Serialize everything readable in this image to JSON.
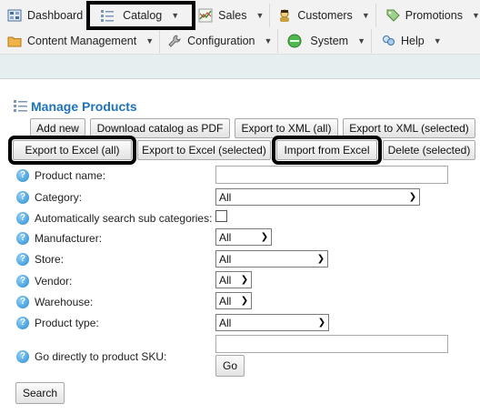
{
  "menu": {
    "row1": [
      {
        "label": "Dashboard",
        "icon": "dashboard-icon"
      },
      {
        "label": "Catalog",
        "icon": "catalog-icon",
        "highlighted": true
      },
      {
        "label": "Sales",
        "icon": "sales-chart-icon"
      },
      {
        "label": "Customers",
        "icon": "customers-icon"
      },
      {
        "label": "Promotions",
        "icon": "promotions-tag-icon"
      }
    ],
    "row2": [
      {
        "label": "Content Management",
        "icon": "folder-icon"
      },
      {
        "label": "Configuration",
        "icon": "wrench-icon"
      },
      {
        "label": "System",
        "icon": "system-globe-icon"
      },
      {
        "label": "Help",
        "icon": "help-people-icon"
      }
    ]
  },
  "page": {
    "title": "Manage Products"
  },
  "toolbar": {
    "add_new": "Add new",
    "download_pdf": "Download catalog as PDF",
    "export_xml_all": "Export to XML (all)",
    "export_xml_selected": "Export to XML (selected)",
    "export_excel_all": "Export to Excel (all)",
    "export_excel_selected": "Export to Excel (selected)",
    "import_excel": "Import from Excel",
    "delete_selected": "Delete (selected)"
  },
  "form": {
    "product_name_label": "Product name:",
    "product_name_value": "",
    "category_label": "Category:",
    "category_value": "All",
    "auto_search_label": "Automatically search sub categories:",
    "auto_search_checked": false,
    "manufacturer_label": "Manufacturer:",
    "manufacturer_value": "All",
    "store_label": "Store:",
    "store_value": "All",
    "vendor_label": "Vendor:",
    "vendor_value": "All",
    "warehouse_label": "Warehouse:",
    "warehouse_value": "All",
    "product_type_label": "Product type:",
    "product_type_value": "All",
    "sku_label": "Go directly to product SKU:",
    "sku_value": "",
    "go_button": "Go",
    "search_button": "Search"
  },
  "colors": {
    "title": "#1e73be",
    "subbar": "#e6efef",
    "highlight_outline": "#000000"
  }
}
